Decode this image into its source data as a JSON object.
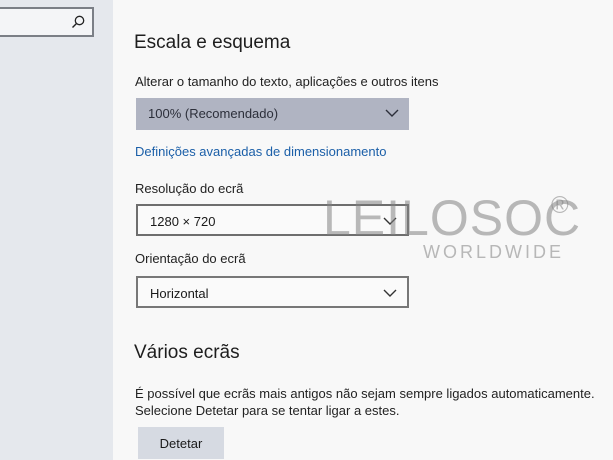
{
  "search": {
    "value": ""
  },
  "display": {
    "scale_heading": "Escala e esquema",
    "scale_label": "Alterar o tamanho do texto, aplicações e outros itens",
    "scale_value": "100% (Recomendado)",
    "advanced_link": "Definições avançadas de dimensionamento",
    "resolution_label": "Resolução do ecrã",
    "resolution_value": "1280 × 720",
    "orientation_label": "Orientação do ecrã",
    "orientation_value": "Horizontal"
  },
  "multiple_displays": {
    "heading": "Vários ecrãs",
    "description": "É possível que ecrãs mais antigos não sejam sempre ligados automaticamente. Selecione Detetar para se tentar ligar a estes.",
    "detect_button": "Detetar"
  },
  "watermark": {
    "brand": "LEILOSOC",
    "registered": "®",
    "sub": "WORLDWIDE"
  },
  "icons": {
    "search": "search-icon",
    "chevron": "chevron-down-icon"
  },
  "colors": {
    "link": "#1b5fa8",
    "selected_dropdown": "#b0b4c2",
    "button": "#d6dae2"
  }
}
